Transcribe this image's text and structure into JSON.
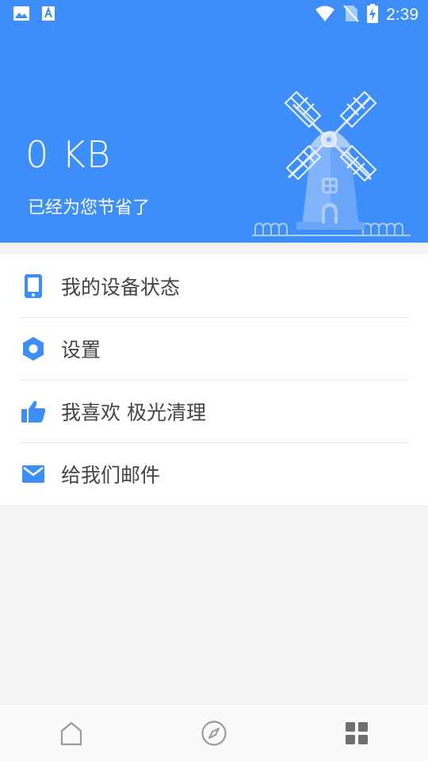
{
  "status_bar": {
    "time": "2:39",
    "left_icons": [
      "image-icon",
      "text-a-icon"
    ],
    "right_icons": [
      "wifi-icon",
      "no-sim-icon",
      "battery-charging-icon"
    ]
  },
  "header": {
    "saved_amount": "0 KB",
    "saved_caption": "已经为您节省了",
    "background_color": "#3d8ef8",
    "illustration": "windmill-illustration"
  },
  "menu": {
    "icon_color": "#3d8ef8",
    "items": [
      {
        "label": "我的设备状态",
        "icon": "phone-icon"
      },
      {
        "label": "设置",
        "icon": "settings-hexagon-icon"
      },
      {
        "label": "我喜欢 极光清理",
        "icon": "thumbs-up-icon"
      },
      {
        "label": "给我们邮件",
        "icon": "mail-icon"
      }
    ]
  },
  "bottom_nav": {
    "items": [
      {
        "icon": "home-icon",
        "active": false
      },
      {
        "icon": "compass-icon",
        "active": false
      },
      {
        "icon": "grid-icon",
        "active": true
      }
    ]
  }
}
